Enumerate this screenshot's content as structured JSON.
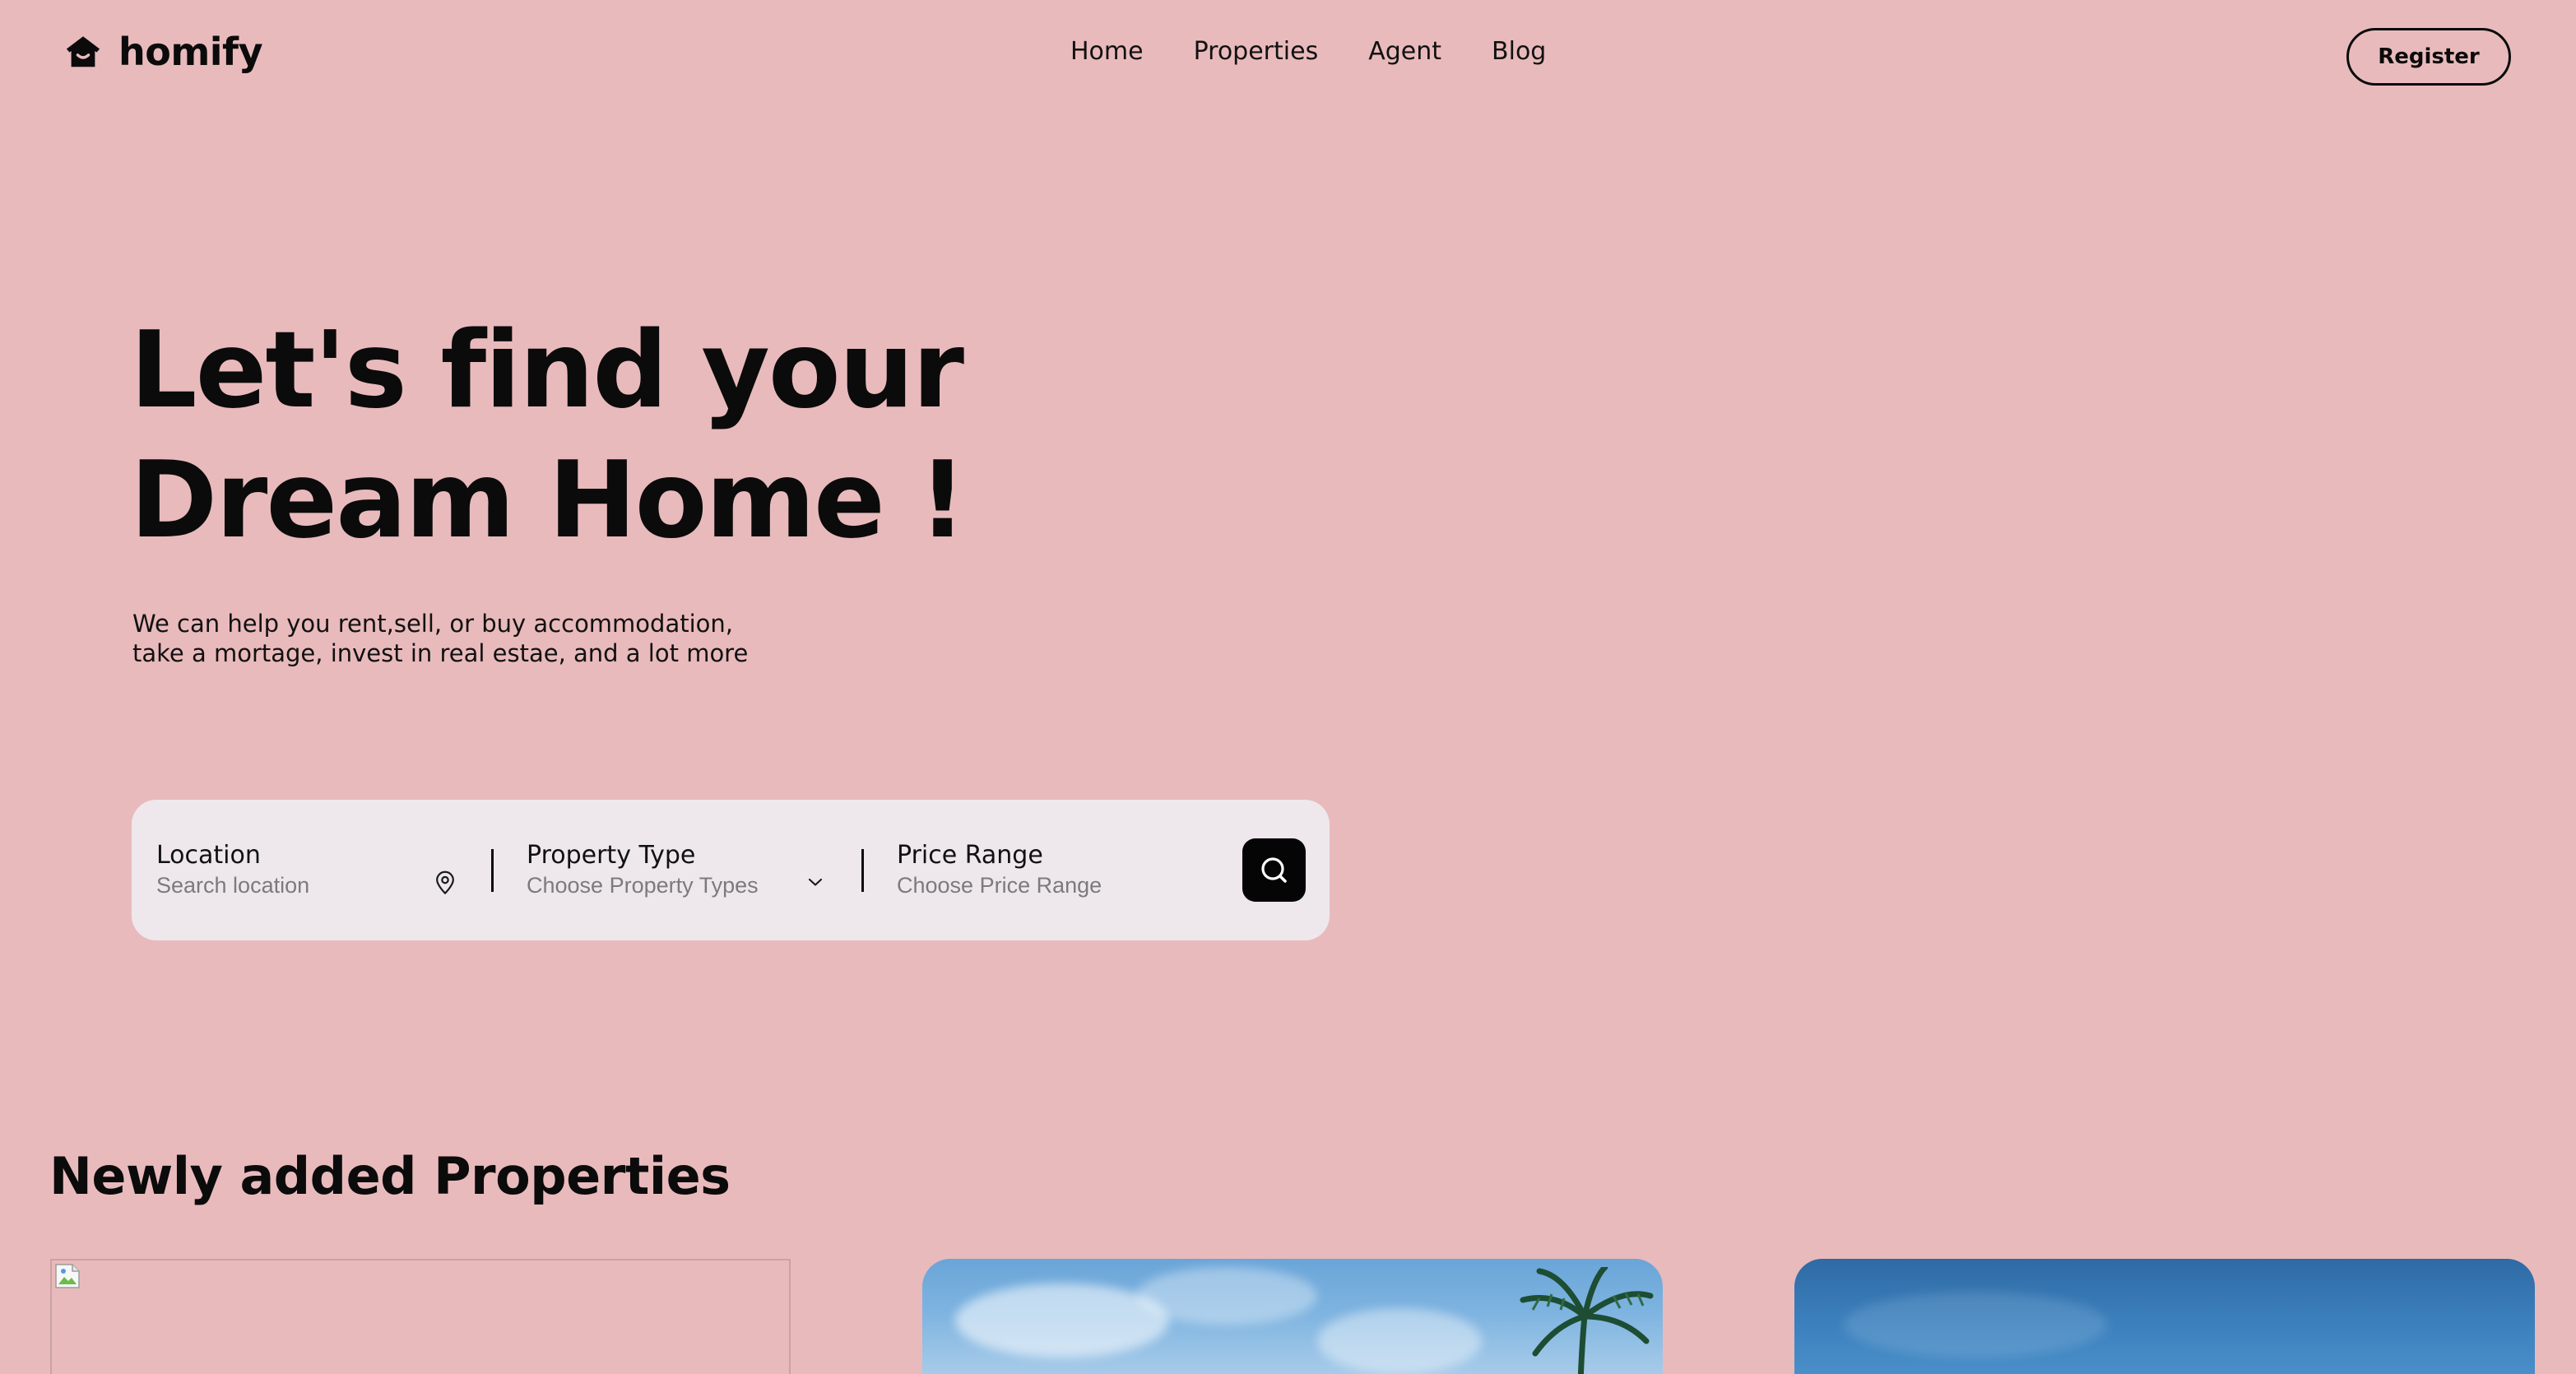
{
  "brand": {
    "name": "homify",
    "icon": "home-icon"
  },
  "nav": {
    "links": [
      "Home",
      "Properties",
      "Agent",
      "Blog"
    ],
    "register_label": "Register"
  },
  "hero": {
    "title_line1": "Let's find your",
    "title_line2": "Dream Home !",
    "subtitle_line1": "We can help you rent,sell, or buy accommodation,",
    "subtitle_line2": "take a mortage, invest in real estae, and a lot more"
  },
  "search": {
    "location": {
      "label": "Location",
      "placeholder": "Search location",
      "icon": "map-pin-icon"
    },
    "property_type": {
      "label": "Property Type",
      "placeholder": "Choose Property Types",
      "icon": "chevron-down-icon"
    },
    "price_range": {
      "label": "Price Range",
      "placeholder": "Choose Price Range"
    },
    "button_icon": "search-icon"
  },
  "properties": {
    "section_title": "Newly added Properties"
  },
  "colors": {
    "background": "#e9babc",
    "search_bar": "#eee8ec",
    "text": "#0b0b0b",
    "placeholder": "#7d7a7c",
    "button": "#050505"
  }
}
